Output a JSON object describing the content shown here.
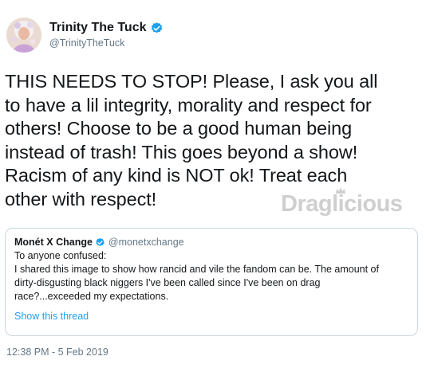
{
  "tweet": {
    "display_name": "Trinity The Tuck",
    "handle": "@TrinityTheTuck",
    "verified_icon": "verified-badge-icon",
    "body_lines": [
      "THIS NEEDS TO STOP! Please, I ask you all",
      "to have a lil integrity, morality and respect for",
      "others! Choose to be a good human being",
      "instead of trash! This goes beyond a show!",
      "Racism of any kind is NOT ok! Treat each",
      "other with respect!"
    ],
    "timestamp": "12:38 PM - 5 Feb 2019"
  },
  "watermark": {
    "text": "Draglicious",
    "color": "#cfcfcf"
  },
  "quoted_tweet": {
    "display_name": "Monét X Change",
    "handle": "@monetxchange",
    "lines": [
      "To anyone confused:",
      "I shared this image to show how rancid and vile the fandom can be. The amount of",
      "dirty-disgusting black niggers I've been called since I've been on drag",
      "race?...exceeded my expectations."
    ],
    "show_thread": "Show this thread"
  },
  "colors": {
    "text": "#14171a",
    "secondary": "#657786",
    "link": "#1da1f2",
    "border": "#ccd6dd"
  }
}
